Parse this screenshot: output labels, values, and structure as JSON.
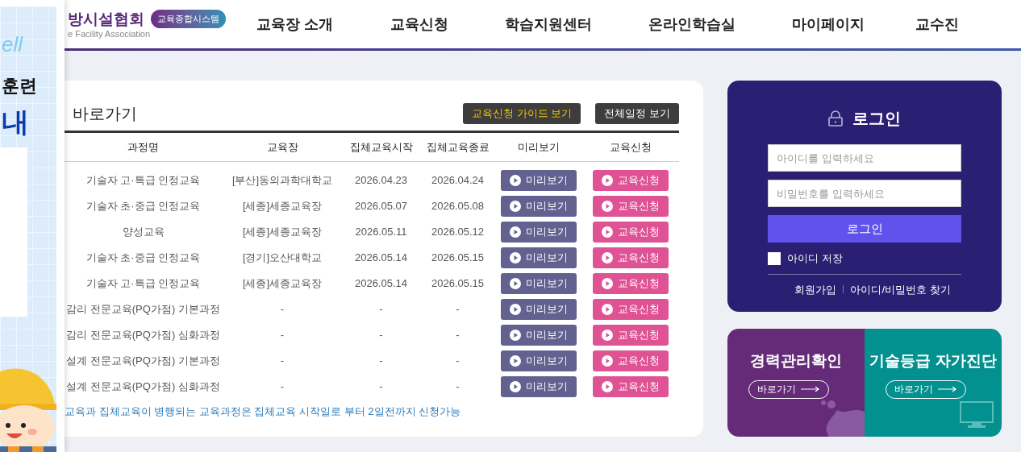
{
  "banner": {
    "script": "ell",
    "headline": "훈련",
    "big": "내"
  },
  "header": {
    "logo_name": "방시설협회",
    "logo_sub": "e Facility Association",
    "badge": "교육종합시스템",
    "nav": [
      {
        "label": "교육장 소개"
      },
      {
        "label": "교육신청"
      },
      {
        "label": "학습지원센터"
      },
      {
        "label": "온라인학습실"
      },
      {
        "label": "마이페이지"
      },
      {
        "label": "교수진"
      }
    ]
  },
  "schedule": {
    "title": "바로가기",
    "buttons": [
      {
        "label": "교육신청 가이드 보기",
        "kind": "highlight"
      },
      {
        "label": "전체일정 보기",
        "kind": "plain"
      }
    ],
    "columns": [
      "과정명",
      "교육장",
      "집체교육시작",
      "집체교육종료",
      "미리보기",
      "교육신청"
    ],
    "rows": [
      {
        "course": "기술자 고·특급 인정교육",
        "place": "[부산]동의과학대학교",
        "start": "2026.04.23",
        "end": "2026.04.24",
        "preview": "미리보기",
        "apply": "교육신청"
      },
      {
        "course": "기술자 초·중급 인정교육",
        "place": "[세종]세종교육장",
        "start": "2026.05.07",
        "end": "2026.05.08",
        "preview": "미리보기",
        "apply": "교육신청"
      },
      {
        "course": "양성교육",
        "place": "[세종]세종교육장",
        "start": "2026.05.11",
        "end": "2026.05.12",
        "preview": "미리보기",
        "apply": "교육신청"
      },
      {
        "course": "기술자 초·중급 인정교육",
        "place": "[경기]오산대학교",
        "start": "2026.05.14",
        "end": "2026.05.15",
        "preview": "미리보기",
        "apply": "교육신청"
      },
      {
        "course": "기술자 고·특급 인정교육",
        "place": "[세종]세종교육장",
        "start": "2026.05.14",
        "end": "2026.05.15",
        "preview": "미리보기",
        "apply": "교육신청"
      },
      {
        "course": "감리 전문교육(PQ가점) 기본과정",
        "place": "-",
        "start": "-",
        "end": "-",
        "preview": "미리보기",
        "apply": "교육신청"
      },
      {
        "course": "감리 전문교육(PQ가점) 심화과정",
        "place": "-",
        "start": "-",
        "end": "-",
        "preview": "미리보기",
        "apply": "교육신청"
      },
      {
        "course": "설계 전문교육(PQ가점) 기본과정",
        "place": "-",
        "start": "-",
        "end": "-",
        "preview": "미리보기",
        "apply": "교육신청"
      },
      {
        "course": "설계 전문교육(PQ가점) 심화과정",
        "place": "-",
        "start": "-",
        "end": "-",
        "preview": "미리보기",
        "apply": "교육신청"
      }
    ],
    "note": "교육과 집체교육이 병행되는 교육과정은 집체교육 시작일로 부터 2일전까지 신청가능"
  },
  "login": {
    "title": "로그인",
    "id_placeholder": "아이디를 입력하세요",
    "pw_placeholder": "비밀번호를 입력하세요",
    "button": "로그인",
    "remember": {
      "label": "아이디 저장",
      "checked": false
    },
    "links": [
      "회원가입",
      "아이디/비밀번호 찾기"
    ]
  },
  "shortcuts": [
    {
      "title": "경력관리확인",
      "link": "바로가기",
      "kind": "career"
    },
    {
      "title": "기술등급 자가진단",
      "link": "바로가기",
      "kind": "diagnosis"
    }
  ]
}
